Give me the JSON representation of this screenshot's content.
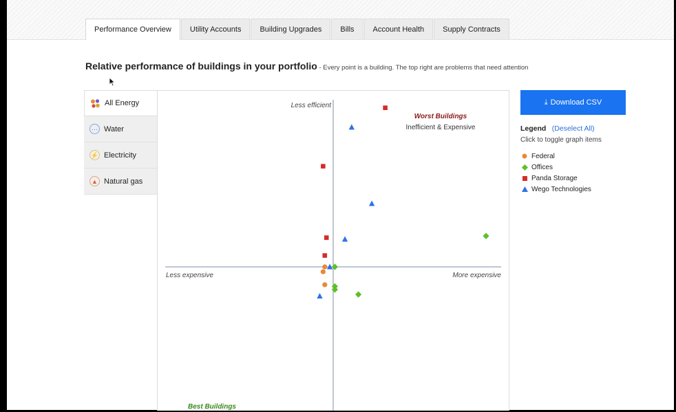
{
  "tabs": [
    {
      "label": "Performance Overview",
      "active": true
    },
    {
      "label": "Utility Accounts",
      "active": false
    },
    {
      "label": "Building Upgrades",
      "active": false
    },
    {
      "label": "Bills",
      "active": false
    },
    {
      "label": "Account Health",
      "active": false
    },
    {
      "label": "Supply Contracts",
      "active": false
    }
  ],
  "heading": {
    "main": "Relative performance of buildings in your portfolio",
    "sub": " - Every point is a building. The top right are problems that need attention"
  },
  "energy_types": [
    {
      "label": "All Energy",
      "icon": "all-energy-icon",
      "active": true
    },
    {
      "label": "Water",
      "icon": "water-icon",
      "active": false
    },
    {
      "label": "Electricity",
      "icon": "electricity-icon",
      "active": false
    },
    {
      "label": "Natural gas",
      "icon": "flame-icon",
      "active": false
    }
  ],
  "download_button": {
    "label": "Download CSV",
    "icon": "download-icon"
  },
  "legend": {
    "title": "Legend",
    "deselect": "(Deselect All)",
    "hint": "Click to toggle graph items",
    "items": [
      {
        "label": "Federal",
        "color": "#e8893a",
        "shape": "circle"
      },
      {
        "label": "Offices",
        "color": "#5dc02a",
        "shape": "diamond"
      },
      {
        "label": "Panda Storage",
        "color": "#d62b2b",
        "shape": "square"
      },
      {
        "label": "Wego Technologies",
        "color": "#2e72e8",
        "shape": "triangle"
      }
    ]
  },
  "chart_data": {
    "type": "scatter",
    "axes_labels": {
      "top": "Less efficient",
      "left": "Less expensive",
      "right": "More expensive"
    },
    "quadrant_labels": {
      "top_right_title": "Worst Buildings",
      "top_right_sub": "Inefficient & Expensive",
      "bottom_left_title": "Best Buildings"
    },
    "xlim": [
      -1,
      1
    ],
    "ylim": [
      -1,
      1
    ],
    "series": [
      {
        "name": "Federal",
        "color": "#e8893a",
        "shape": "circle",
        "points": [
          [
            -0.05,
            0.0
          ],
          [
            -0.06,
            -0.03
          ],
          [
            -0.05,
            -0.11
          ]
        ]
      },
      {
        "name": "Offices",
        "color": "#5dc02a",
        "shape": "diamond",
        "points": [
          [
            0.01,
            0.0
          ],
          [
            0.01,
            -0.12
          ],
          [
            0.01,
            -0.14
          ],
          [
            0.15,
            -0.17
          ],
          [
            0.91,
            0.19
          ]
        ]
      },
      {
        "name": "Panda Storage",
        "color": "#d62b2b",
        "shape": "square",
        "points": [
          [
            0.31,
            0.98
          ],
          [
            -0.06,
            0.62
          ],
          [
            -0.04,
            0.18
          ],
          [
            -0.05,
            0.07
          ]
        ]
      },
      {
        "name": "Wego Technologies",
        "color": "#2e72e8",
        "shape": "triangle",
        "points": [
          [
            0.11,
            0.86
          ],
          [
            0.23,
            0.39
          ],
          [
            0.07,
            0.17
          ],
          [
            -0.02,
            0.0
          ],
          [
            -0.08,
            -0.18
          ]
        ]
      }
    ]
  }
}
